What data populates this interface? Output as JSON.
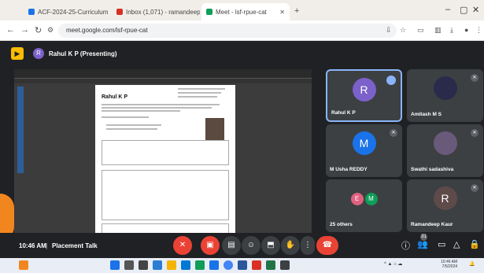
{
  "browser": {
    "tabs": [
      {
        "title": "ACF-2024-25-Curriculum - Goo",
        "favicon_color": "#1a73e8"
      },
      {
        "title": "Inbox (1,071) - ramandeep.k@",
        "favicon_color": "#d93025"
      },
      {
        "title": "Meet - lsf-rpue-cat",
        "favicon_color": "#0f9d58"
      }
    ],
    "url": "meet.google.com/lsf-rpue-cat"
  },
  "meet": {
    "presenter_label": "Rahul K P (Presenting)",
    "presenter_initial": "R",
    "shared_document": {
      "name": "Rahul K P"
    },
    "participants": [
      {
        "name": "Rahul K P",
        "initial": "R",
        "color": "#7b61c9",
        "speaking": true
      },
      {
        "name": "Amitash M S",
        "initial": "",
        "color": "#2a2a4a",
        "speaking": false
      },
      {
        "name": "M Usha REDDY",
        "initial": "M",
        "color": "#1a73e8",
        "speaking": false
      },
      {
        "name": "Swathi sadashiva",
        "initial": "",
        "color": "#6a5a7a",
        "speaking": false
      },
      {
        "name": "25 others",
        "initial": "E M",
        "color": "#e06080",
        "speaking": false
      },
      {
        "name": "Ramandeep Kaur",
        "initial": "R",
        "color": "#5f4a4a",
        "speaking": false
      }
    ],
    "meeting_time": "10:46 AM",
    "meeting_name": "Placement Talk",
    "participant_count": "31"
  },
  "taskbar": {
    "time": "10:46 AM",
    "date": "7/5/2024"
  }
}
